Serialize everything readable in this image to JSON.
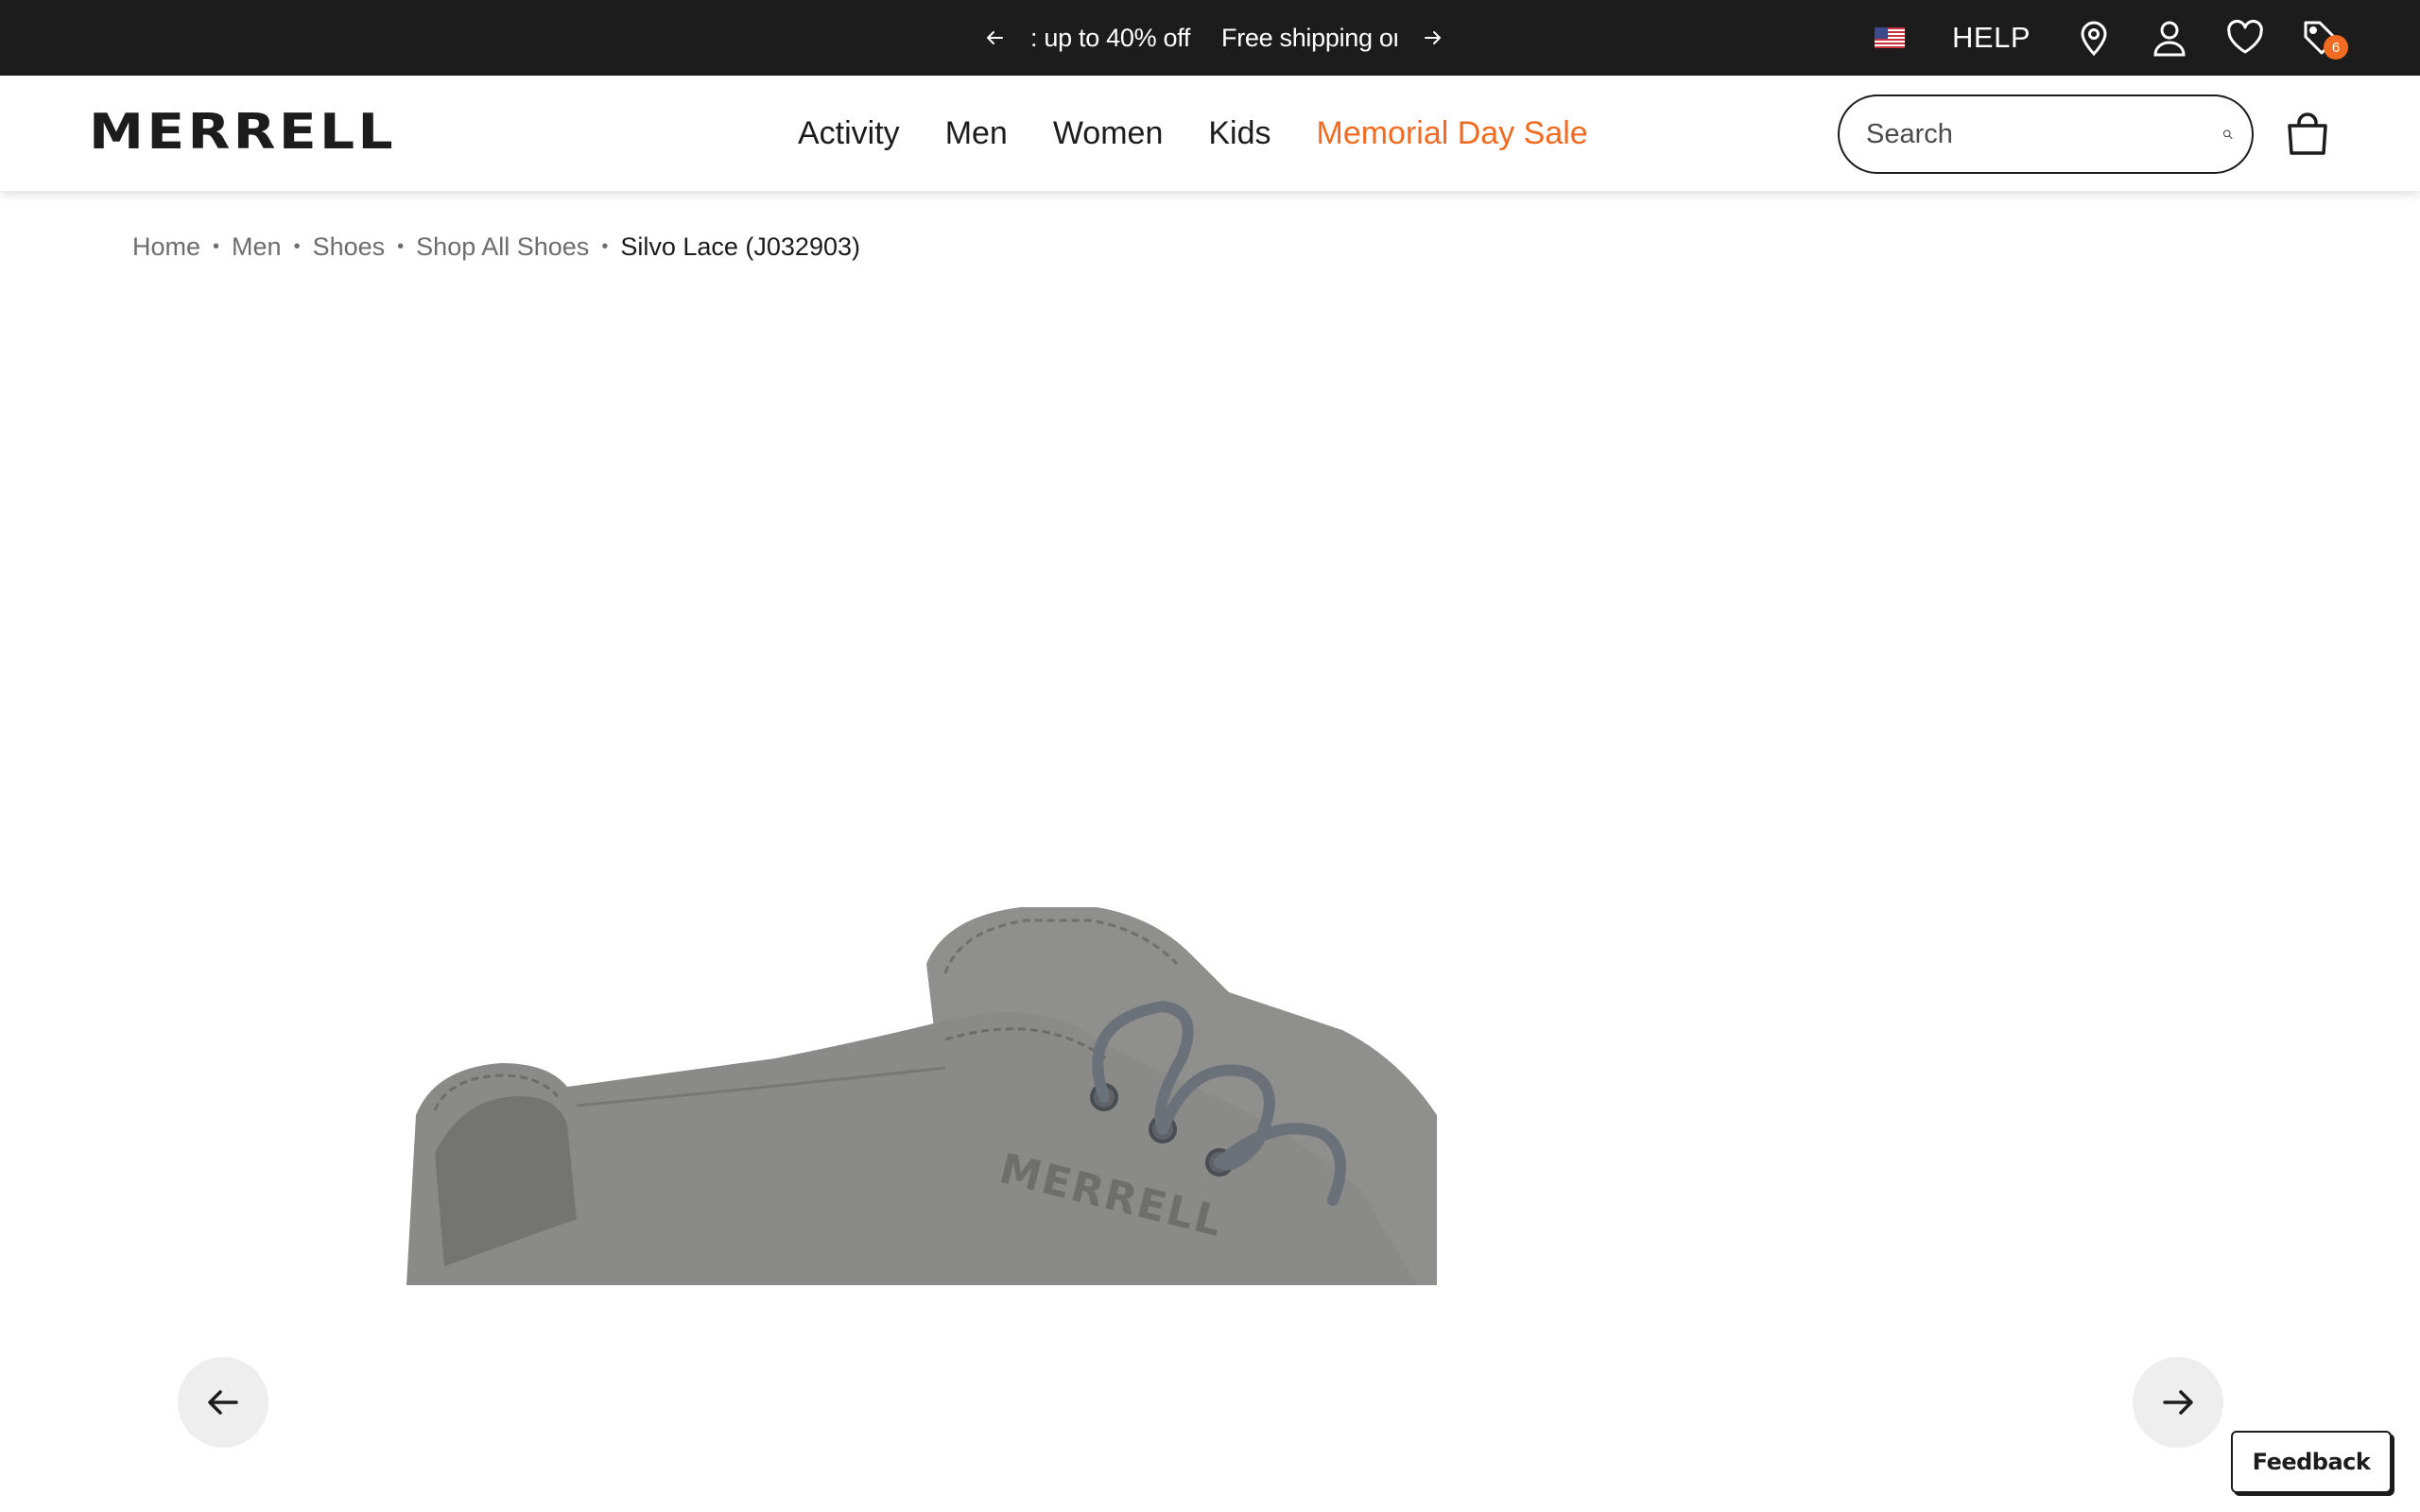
{
  "promo": {
    "message_1": ": up to 40% off",
    "message_2": "Free shipping on"
  },
  "utility": {
    "help_label": "HELP",
    "offers_badge_count": "6"
  },
  "header": {
    "logo": "MERRELL",
    "nav": [
      {
        "label": "Activity"
      },
      {
        "label": "Men"
      },
      {
        "label": "Women"
      },
      {
        "label": "Kids"
      },
      {
        "label": "Memorial Day Sale"
      }
    ],
    "search": {
      "placeholder": "Search"
    }
  },
  "breadcrumb": [
    {
      "label": "Home"
    },
    {
      "label": "Men"
    },
    {
      "label": "Shoes"
    },
    {
      "label": "Shop All Shoes"
    },
    {
      "label": "Silvo Lace (J032903)"
    }
  ],
  "product": {
    "shoe_logo_text": "MERRELL"
  },
  "feedback": {
    "label": "Feedback"
  },
  "colors": {
    "accent_sale": "#f26b21",
    "promo_bg": "#1c1c1c",
    "shoe_gray": "#8d8d8b",
    "lace_blue_gray": "#6b7178"
  },
  "icons": {
    "promo_prev": "arrow-left-icon",
    "promo_next": "arrow-right-icon",
    "flag": "us-flag-icon",
    "store": "location-pin-icon",
    "account": "user-icon",
    "wishlist": "heart-icon",
    "offers": "tag-icon",
    "search": "search-icon",
    "bag": "shopping-bag-icon",
    "carousel_prev": "arrow-left-icon",
    "carousel_next": "arrow-right-icon"
  }
}
